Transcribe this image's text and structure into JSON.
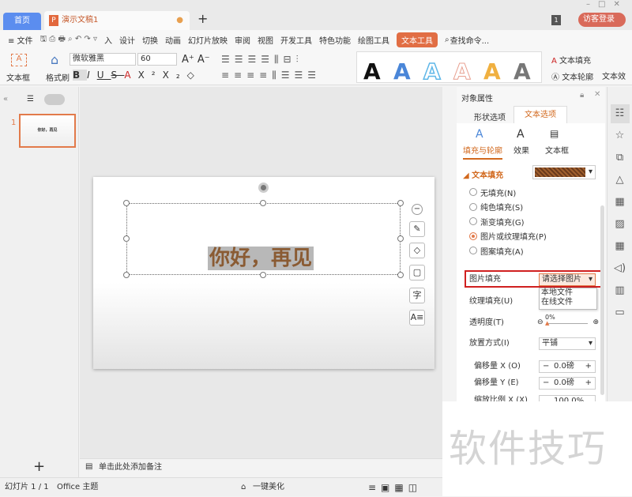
{
  "tabs": {
    "home": "首页",
    "doc": "演示文稿1",
    "doc_icon": "P",
    "new": "+"
  },
  "titlebar": {
    "badge": "1",
    "login": "访客登录"
  },
  "menu": {
    "items": [
      "≡ 文件",
      "入",
      "设计",
      "切换",
      "动画",
      "幻灯片放映",
      "审阅",
      "视图",
      "开发工具",
      "特色功能",
      "绘图工具"
    ],
    "active": "文本工具",
    "search": "查找命令..."
  },
  "ribbon": {
    "textbox": "文本框",
    "format_painter": "格式刷",
    "font": "微软雅黑",
    "size": "60",
    "text_fill": "文本填充",
    "text_outline": "文本轮廓",
    "text_effect": "文本效",
    "style_glyph": "A",
    "style_colors": [
      "#111111",
      "#4a86d8",
      "#5fb7e8",
      "#e8b9a8",
      "#f0b040",
      "#777777"
    ]
  },
  "slide_panel": {
    "number": "1",
    "thumb_text": "你好，再见"
  },
  "slide": {
    "text": "你好，再见"
  },
  "notes": "单击此处添加备注",
  "status": {
    "slide": "幻灯片 1 / 1",
    "theme": "Office 主题",
    "beautify": "一键美化"
  },
  "panel": {
    "title": "对象属性",
    "tabs": [
      "形状选项",
      "文本选项"
    ],
    "subtabs": [
      "填充与轮廓",
      "效果",
      "文本框"
    ],
    "section": "文本填充",
    "options": [
      "无填充(N)",
      "纯色填充(S)",
      "渐变填充(G)",
      "图片或纹理填充(P)",
      "图案填充(A)"
    ],
    "selected_option": 3,
    "picture_fill_label": "图片填充",
    "picture_fill_value": "请选择图片",
    "dropdown": [
      "本地文件",
      "在线文件"
    ],
    "texture_label": "纹理填充(U)",
    "transparency_label": "透明度(T)",
    "transparency": "0%",
    "placement_label": "放置方式(I)",
    "placement": "平铺",
    "offset_x_label": "偏移量 X (O)",
    "offset_x": "0.0磅",
    "offset_y_label": "偏移量 Y (E)",
    "offset_y": "0.0磅",
    "scale_x_label": "缩放比例 X (X)",
    "scale_x": "100.0%"
  },
  "watermark": "软件技巧",
  "accent": "#e16e44"
}
